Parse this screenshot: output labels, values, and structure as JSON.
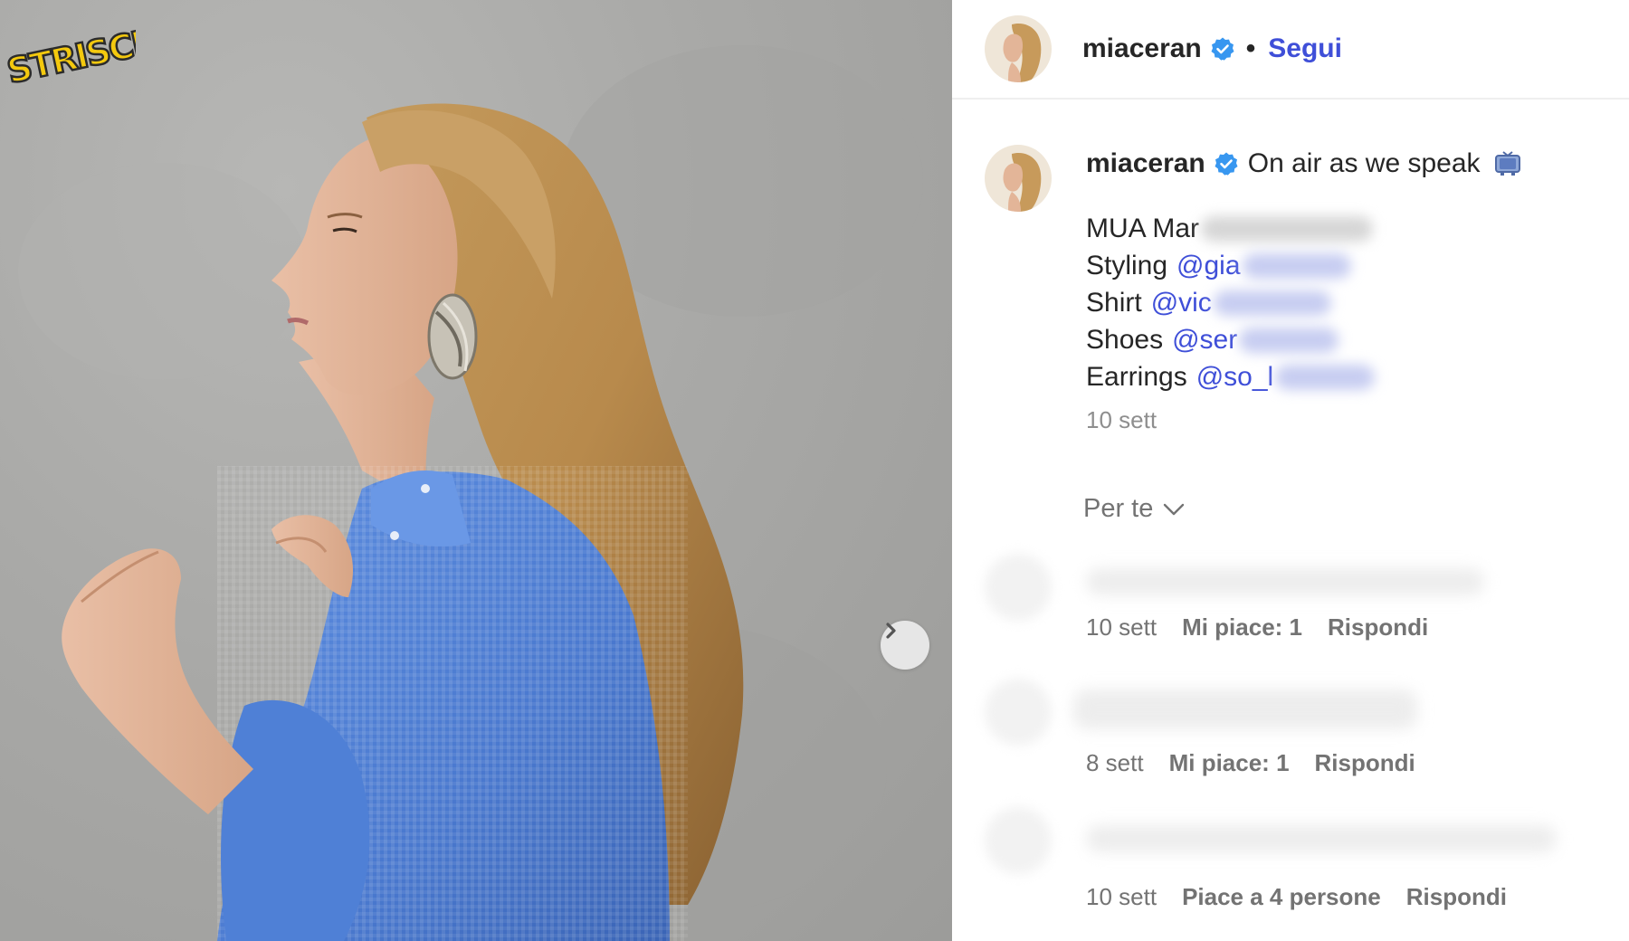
{
  "post": {
    "username": "miaceran",
    "separator": "•",
    "follow_label": "Segui",
    "next_icon": "chevron-right-icon",
    "verified_color": "#3897f0",
    "link_color": "#3f4fd8",
    "watermark_text": "STRISCIA"
  },
  "caption": {
    "username": "miaceran",
    "text": "On air as we speak",
    "emoji_icon": "television-icon",
    "credits": [
      {
        "label": "MUA Mar",
        "mention": ""
      },
      {
        "label": "Styling",
        "mention": "@gia"
      },
      {
        "label": "Shirt",
        "mention": "@vic"
      },
      {
        "label": "Shoes",
        "mention": "@ser"
      },
      {
        "label": "Earrings",
        "mention": "@so_l"
      }
    ],
    "time": "10 sett"
  },
  "comments_filter": {
    "label": "Per te",
    "icon": "chevron-down-icon"
  },
  "comments": [
    {
      "time": "10 sett",
      "likes": "Mi piace: 1",
      "reply": "Rispondi"
    },
    {
      "time": "8 sett",
      "likes": "Mi piace: 1",
      "reply": "Rispondi"
    },
    {
      "time": "10 sett",
      "likes": "Piace a 4 persone",
      "reply": "Rispondi"
    }
  ]
}
